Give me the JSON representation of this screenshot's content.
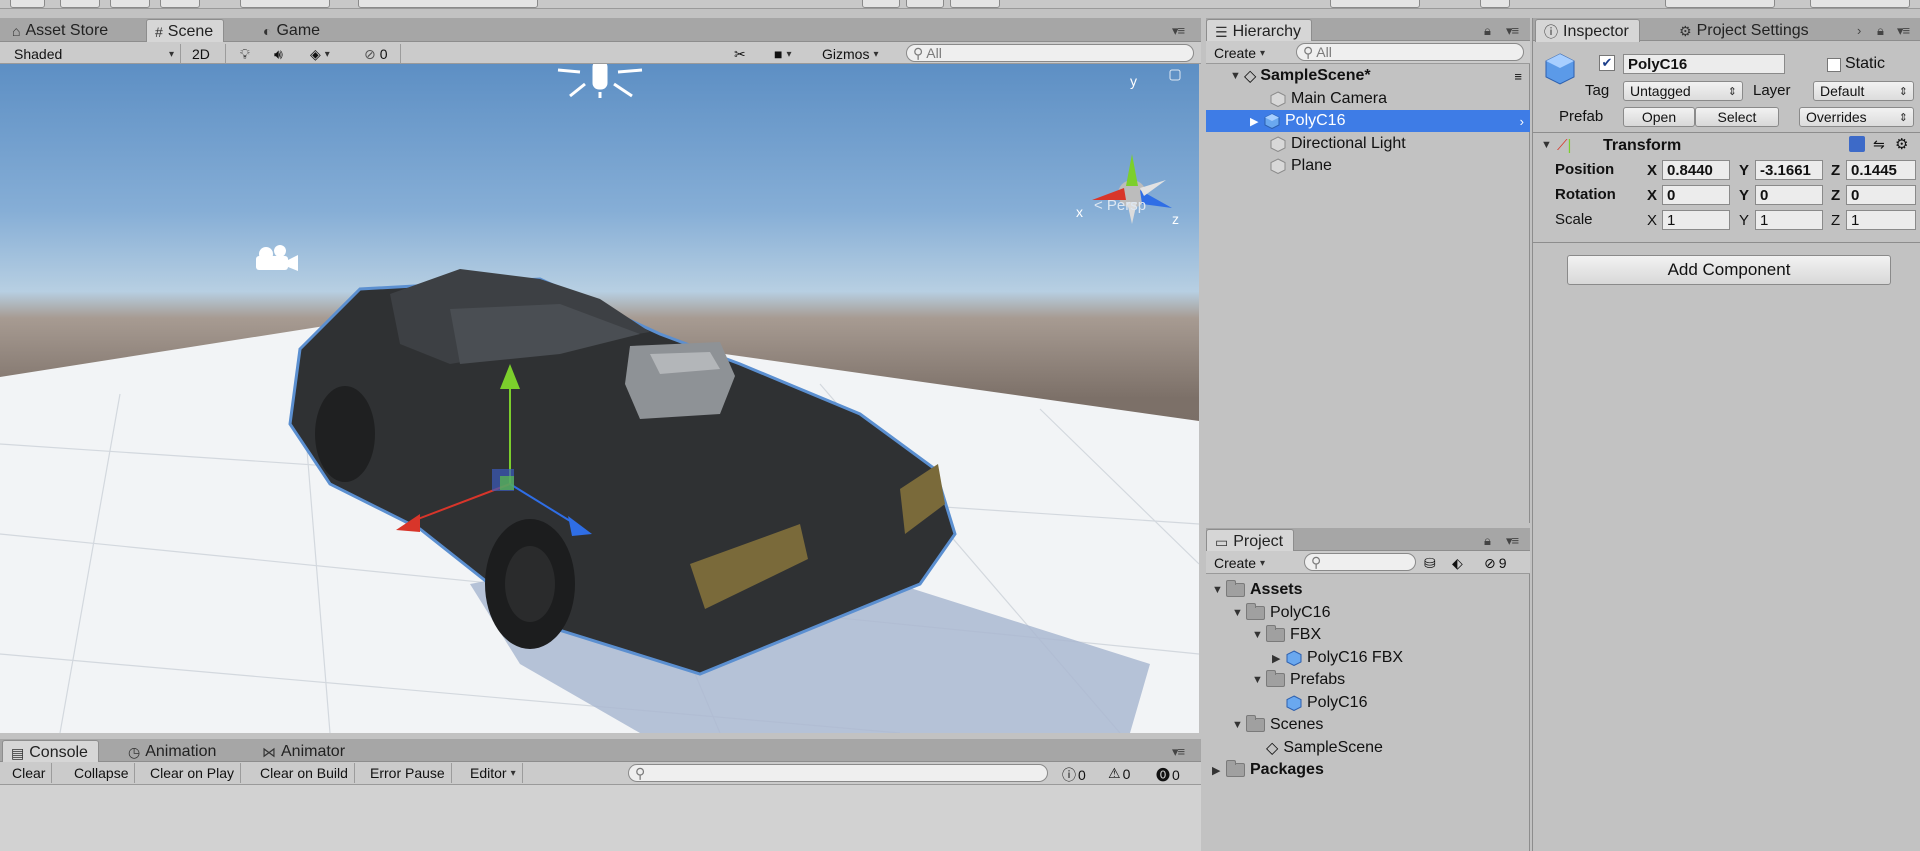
{
  "scene_tabs": [
    {
      "label": "Asset Store",
      "icon": "store-icon"
    },
    {
      "label": "Scene",
      "icon": "grid-icon"
    },
    {
      "label": "Game",
      "icon": "game-icon"
    }
  ],
  "scene_toolbar": {
    "draw_mode": "Shaded",
    "mode_2d": "2D",
    "hidden_count": "0",
    "gizmos": "Gizmos",
    "search_placeholder": "All"
  },
  "scene_view": {
    "projection_label": "< Persp",
    "gizmo_axes": {
      "x": "x",
      "y": "y",
      "z": "z"
    }
  },
  "hierarchy": {
    "tab": "Hierarchy",
    "create": "Create",
    "search_placeholder": "All",
    "scene_name": "SampleScene*",
    "items": [
      {
        "label": "Main Camera",
        "selected": false
      },
      {
        "label": "PolyC16",
        "selected": true
      },
      {
        "label": "Directional Light",
        "selected": false
      },
      {
        "label": "Plane",
        "selected": false
      }
    ]
  },
  "project": {
    "tab": "Project",
    "create": "Create",
    "hidden_count": "9",
    "tree": {
      "assets": "Assets",
      "polyc16": "PolyC16",
      "fbx": "FBX",
      "fbx_model": "PolyC16 FBX",
      "prefabs": "Prefabs",
      "prefab_item": "PolyC16",
      "scenes": "Scenes",
      "scene_item": "SampleScene",
      "packages": "Packages"
    }
  },
  "inspector": {
    "tab": "Inspector",
    "tab2": "Project Settings",
    "object_name": "PolyC16",
    "active": true,
    "static_label": "Static",
    "tag_label": "Tag",
    "tag_value": "Untagged",
    "layer_label": "Layer",
    "layer_value": "Default",
    "prefab_label": "Prefab",
    "prefab_open": "Open",
    "prefab_select": "Select",
    "prefab_overrides": "Overrides",
    "transform": {
      "title": "Transform",
      "position_label": "Position",
      "rotation_label": "Rotation",
      "scale_label": "Scale",
      "position": {
        "x": "0.8440",
        "y": "-3.1661",
        "z": "0.1445"
      },
      "rotation": {
        "x": "0",
        "y": "0",
        "z": "0"
      },
      "scale": {
        "x": "1",
        "y": "1",
        "z": "1"
      }
    },
    "add_component": "Add Component"
  },
  "console": {
    "tabs": [
      "Console",
      "Animation",
      "Animator"
    ],
    "buttons": [
      "Clear",
      "Collapse",
      "Clear on Play",
      "Clear on Build",
      "Error Pause",
      "Editor"
    ],
    "info_count": "0",
    "warning_count": "0",
    "error_count": "0"
  },
  "colors": {
    "selection": "#3e7ce6",
    "axis_x": "#d8352a",
    "axis_y": "#7ccf2c",
    "axis_z": "#2f6ee6"
  }
}
